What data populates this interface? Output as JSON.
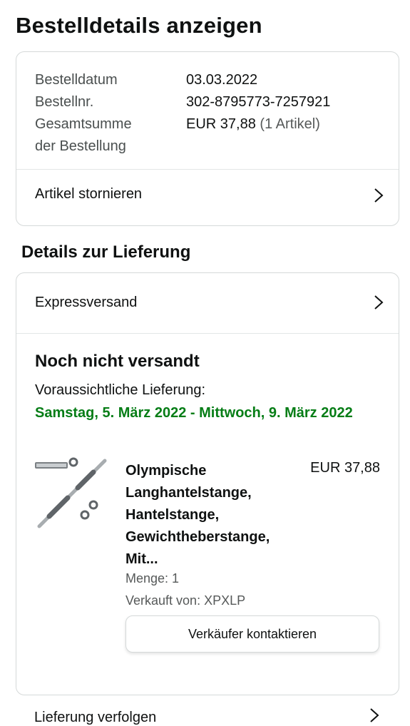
{
  "page": {
    "title": "Bestelldetails anzeigen"
  },
  "summary": {
    "date_label": "Bestelldatum",
    "date_value": "03.03.2022",
    "order_label": "Bestellnr.",
    "order_value": "302-8795773-7257921",
    "total_label_line1": "Gesamtsumme",
    "total_label_line2": "der Bestellung",
    "total_value": "EUR 37,88",
    "total_items": "(1 Artikel)",
    "cancel_label": "Artikel stornieren"
  },
  "delivery": {
    "section_title": "Details zur Lieferung",
    "shipping_method": "Expressversand",
    "status": "Noch nicht versandt",
    "eta_label": "Voraussichtliche Lieferung:",
    "eta_dates": "Samstag, 5. März 2022 - Mittwoch, 9. März 2022"
  },
  "product": {
    "title_lines": [
      "Olympische",
      "Langhantelstange,",
      "Hantelstange,",
      "Gewichtheberstange,",
      "Mit..."
    ],
    "price": "EUR 37,88",
    "quantity": "Menge: 1",
    "seller": "Verkauft von: XPXLP",
    "contact_button": "Verkäufer kontaktieren"
  },
  "bottom": {
    "partial_label": "Lieferung verfolgen"
  },
  "colors": {
    "eta_green": "#067d16",
    "border": "#d5d9d9",
    "muted": "#565959"
  },
  "icons": {
    "chevron": "chevron-right-icon",
    "product": "barbell-product-image"
  }
}
